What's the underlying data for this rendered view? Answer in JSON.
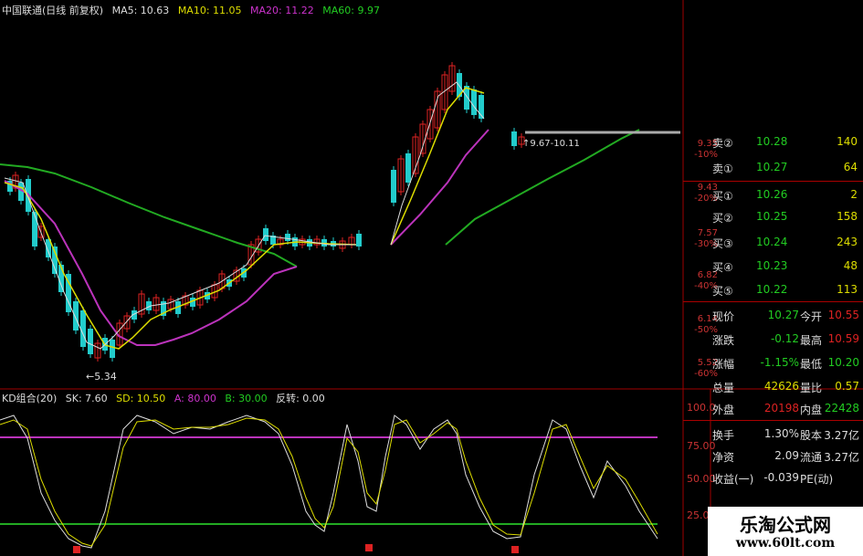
{
  "header": {
    "title": "中国联通(日线 前复权)",
    "ma5_label": "MA5: 10.63",
    "ma10_label": "MA10: 11.05",
    "ma20_label": "MA20: 11.22",
    "ma60_label": "MA60: 9.97"
  },
  "price_axis": {
    "labels": [
      {
        "price": "9.35",
        "pct": "-10%"
      },
      {
        "price": "9.43",
        "pct": "-20%"
      },
      {
        "price": "7.57",
        "pct": "-30%"
      },
      {
        "price": "6.82",
        "pct": "-40%"
      },
      {
        "price": "6.14",
        "pct": "-50%"
      },
      {
        "price": "5.52",
        "pct": "-60%"
      }
    ]
  },
  "annotations": {
    "low_marker": "5.34",
    "range_marker": "9.67-10.11"
  },
  "oscillator": {
    "title": "KD组合(20)",
    "sk": "SK: 7.60",
    "sd": "SD: 10.50",
    "a": "A: 80.00",
    "b": "B: 30.00",
    "fz": "反转: 0.00",
    "axis": [
      "100.0",
      "75.00",
      "50.00",
      "25.00"
    ]
  },
  "order_book": [
    {
      "side": "卖②",
      "price": "10.28",
      "vol": "140"
    },
    {
      "side": "卖①",
      "price": "10.27",
      "vol": "64"
    },
    {
      "side": "买①",
      "price": "10.26",
      "vol": "2"
    },
    {
      "side": "买②",
      "price": "10.25",
      "vol": "158"
    },
    {
      "side": "买③",
      "price": "10.24",
      "vol": "243"
    },
    {
      "side": "买④",
      "price": "10.23",
      "vol": "48"
    },
    {
      "side": "买⑤",
      "price": "10.22",
      "vol": "113"
    }
  ],
  "quote": [
    {
      "l1": "现价",
      "v1": "10.27",
      "l2": "今开",
      "v2": "10.55",
      "c1": "#2c2",
      "c2": "#d22"
    },
    {
      "l1": "涨跌",
      "v1": "-0.12",
      "l2": "最高",
      "v2": "10.59",
      "c1": "#2c2",
      "c2": "#d22"
    },
    {
      "l1": "涨幅",
      "v1": "-1.15%",
      "l2": "最低",
      "v2": "10.20",
      "c1": "#2c2",
      "c2": "#2c2"
    },
    {
      "l1": "总量",
      "v1": "42626",
      "l2": "量比",
      "v2": "0.57",
      "c1": "#dd0",
      "c2": "#dd0"
    },
    {
      "l1": "外盘",
      "v1": "20198",
      "l2": "内盘",
      "v2": "22428",
      "c1": "#d22",
      "c2": "#2c2"
    },
    {
      "l1": "换手",
      "v1": "1.30%",
      "l2": "股本",
      "v2": "3.27亿",
      "c1": "#ddd",
      "c2": "#ddd"
    },
    {
      "l1": "净资",
      "v1": "2.09",
      "l2": "流通",
      "v2": "3.27亿",
      "c1": "#ddd",
      "c2": "#ddd"
    },
    {
      "l1": "收益(一)",
      "v1": "-0.039",
      "l2": "PE(动)",
      "v2": "",
      "c1": "#ddd",
      "c2": "#ddd"
    }
  ],
  "watermark": {
    "line1": "乐淘公式网",
    "line2": "www.60lt.com"
  },
  "colors": {
    "up": "#d22",
    "down": "#2cc",
    "ma5": "#dddddd",
    "ma10": "#dddd00",
    "ma20": "#cc33cc",
    "ma60": "#22bb22",
    "grid": "#a00000"
  }
}
